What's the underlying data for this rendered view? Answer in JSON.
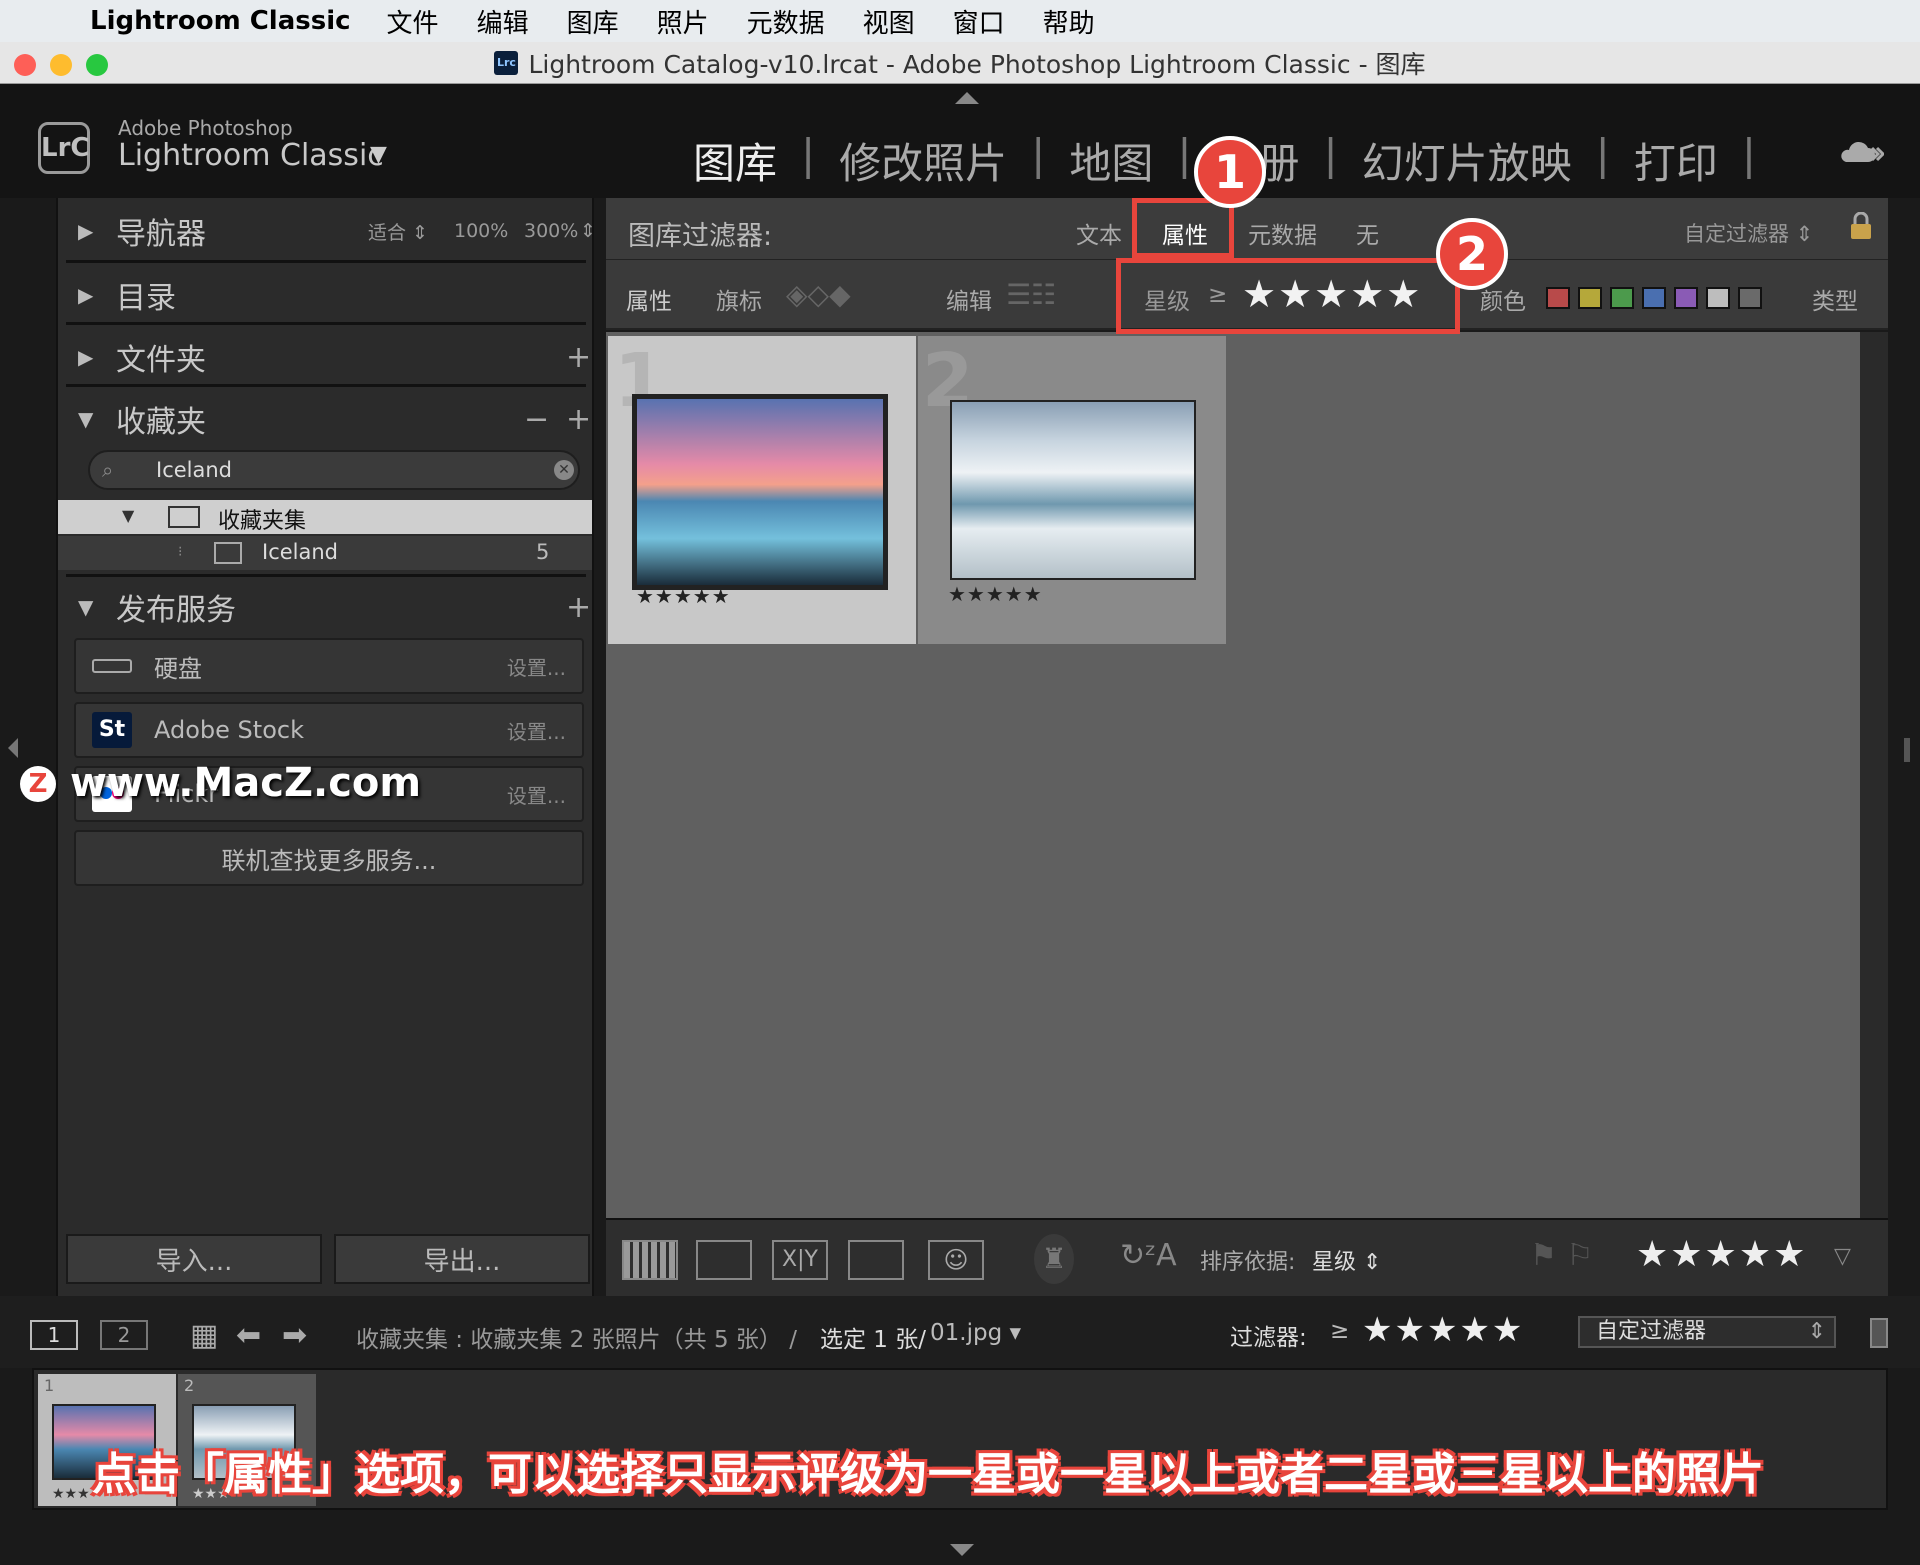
{
  "menubar": {
    "app": "Lightroom Classic",
    "items": [
      "文件",
      "编辑",
      "图库",
      "照片",
      "元数据",
      "视图",
      "窗口",
      "帮助"
    ]
  },
  "titlebar": {
    "icon_text": "Lrc",
    "title": "Lightroom Catalog-v10.lrcat - Adobe Photoshop Lightroom Classic - 图库"
  },
  "identity": {
    "line1": "Adobe Photoshop",
    "line2": "Lightroom Classic",
    "dropdown": "▼",
    "logo": "LrC"
  },
  "modules": [
    "图库",
    "修改照片",
    "地图",
    "画册",
    "幻灯片放映",
    "打印"
  ],
  "left": {
    "navigator": {
      "label": "导航器",
      "fit": "适合 ⇕",
      "zoom1": "100%",
      "zoom2": "300%",
      "zoom_arrow": "⇕"
    },
    "catalog": "目录",
    "folders": "文件夹",
    "collections": {
      "label": "收藏夹",
      "search": "Iceland",
      "set": "收藏夹集",
      "item": "Iceland",
      "count": "5"
    },
    "publish": {
      "label": "发布服务",
      "services": [
        {
          "name": "硬盘",
          "setup": "设置..."
        },
        {
          "name": "Adobe Stock",
          "setup": "设置...",
          "icon": "St"
        },
        {
          "name": "Flickr",
          "setup": "设置..."
        }
      ],
      "find_more": "联机查找更多服务..."
    },
    "import": "导入...",
    "export": "导出..."
  },
  "filter": {
    "title": "图库过滤器:",
    "tabs": [
      "文本",
      "属性",
      "元数据",
      "无"
    ],
    "custom": "自定过滤器 ⇕",
    "row2": {
      "attr": "属性",
      "flag": "旗标",
      "edit": "编辑",
      "rating": "星级",
      "ge": "≥",
      "stars": "★★★★★",
      "color": "颜色",
      "type": "类型"
    },
    "colors": [
      "#b84a4a",
      "#b5a83a",
      "#4c9a4c",
      "#4a6fb0",
      "#8a5bb5",
      "#bdbdbd",
      "#6a6a6a"
    ]
  },
  "grid": {
    "cells": [
      {
        "index": "1",
        "stars": "★★★★★"
      },
      {
        "index": "2",
        "stars": "★★★★★"
      }
    ]
  },
  "toolbar": {
    "sort_label": "排序依据:",
    "sort_value": "星级 ⇕",
    "stars": "★★★★★"
  },
  "filmstrip_bar": {
    "screen1": "1",
    "screen2": "2",
    "path": "收藏夹集 : 收藏夹集   2 张照片（共 5 张） /",
    "selected": "选定 1 张/",
    "file": "01.jpg ▾",
    "filter_label": "过滤器:",
    "filter_ge": "≥",
    "filter_stars": "★★★★★",
    "custom_filter": "自定过滤器"
  },
  "filmstrip": {
    "thumbs": [
      {
        "index": "1",
        "stars": "★★★"
      },
      {
        "index": "2",
        "stars": "★★★"
      }
    ]
  },
  "overlay": {
    "badge1": "1",
    "badge2": "2",
    "watermark": "www.MacZ.com",
    "watermark_logo": "Z",
    "caption": "点击「属性」选项，可以选择只显示评级为一星或一星以上或者二星或三星以上的照片"
  }
}
